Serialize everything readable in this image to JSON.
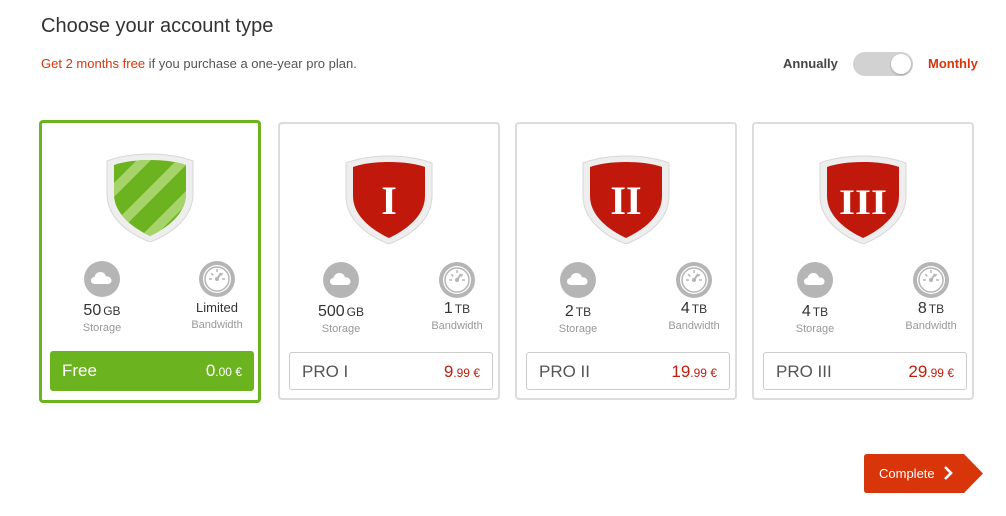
{
  "header": {
    "title": "Choose your account type",
    "promo_highlight": "Get 2 months free",
    "promo_rest": " if you purchase a one-year pro plan."
  },
  "billing_toggle": {
    "left_label": "Annually",
    "right_label": "Monthly",
    "selected": "Monthly"
  },
  "plans": [
    {
      "name": "Free",
      "shield_label": "",
      "storage_value": "50",
      "storage_unit": "GB",
      "storage_caption": "Storage",
      "bandwidth_value": "Limited",
      "bandwidth_unit": "",
      "bandwidth_caption": "Bandwidth",
      "price_main": "0",
      "price_cents": ".00 €",
      "selected": true
    },
    {
      "name": "PRO I",
      "shield_label": "I",
      "storage_value": "500",
      "storage_unit": "GB",
      "storage_caption": "Storage",
      "bandwidth_value": "1",
      "bandwidth_unit": "TB",
      "bandwidth_caption": "Bandwidth",
      "price_main": "9",
      "price_cents": ".99 €",
      "selected": false
    },
    {
      "name": "PRO II",
      "shield_label": "II",
      "storage_value": "2",
      "storage_unit": "TB",
      "storage_caption": "Storage",
      "bandwidth_value": "4",
      "bandwidth_unit": "TB",
      "bandwidth_caption": "Bandwidth",
      "price_main": "19",
      "price_cents": ".99 €",
      "selected": false
    },
    {
      "name": "PRO III",
      "shield_label": "III",
      "storage_value": "4",
      "storage_unit": "TB",
      "storage_caption": "Storage",
      "bandwidth_value": "8",
      "bandwidth_unit": "TB",
      "bandwidth_caption": "Bandwidth",
      "price_main": "29",
      "price_cents": ".99 €",
      "selected": false
    }
  ],
  "icons": {
    "storage": "cloud-icon",
    "bandwidth": "speedometer-icon",
    "free_shield": "green-striped-shield-icon",
    "pro_shield": "red-shield-icon"
  },
  "colors": {
    "accent_red": "#d9350b",
    "price_red": "#c0200f",
    "selected_green": "#6cb320",
    "shield_red": "#c1180c"
  },
  "actions": {
    "complete_label": "Complete"
  }
}
